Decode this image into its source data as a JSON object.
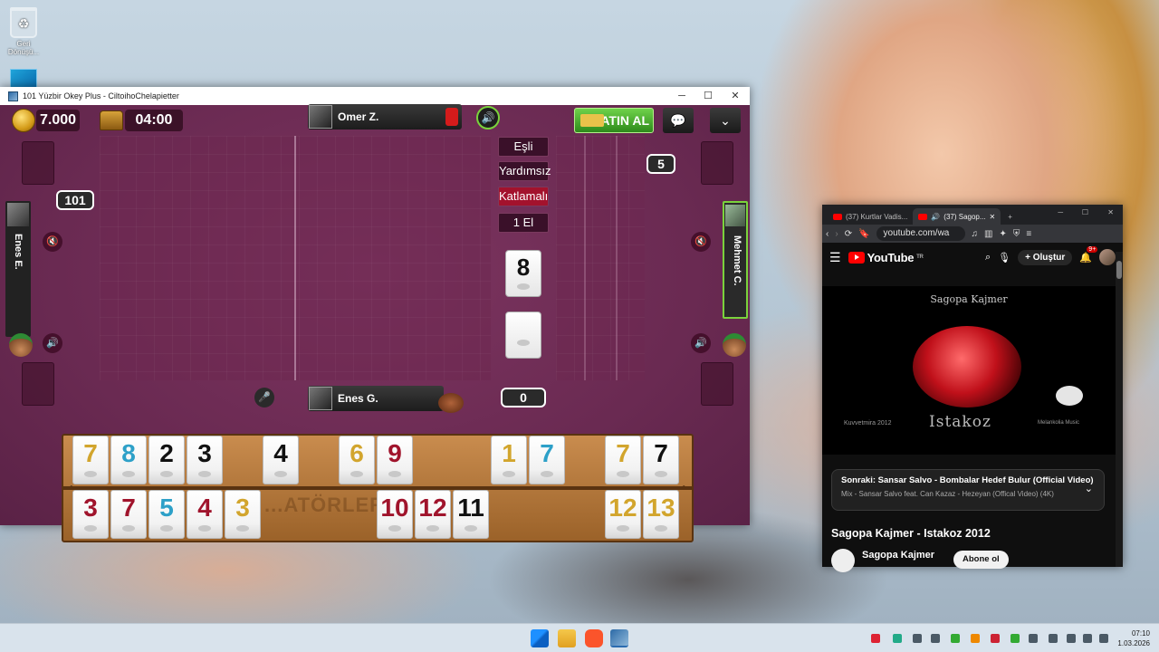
{
  "desktop": {
    "recycle_bin_label": "Geri Dönüşü...",
    "second_icon_label": ""
  },
  "game_window": {
    "title": "101 Yüzbir Okey Plus - CiltoihoChelapietter",
    "controls": {
      "minimize": "─",
      "maximize": "☐",
      "close": "✕"
    },
    "coins": "7.000",
    "timer": "04:00",
    "top_player": "Omer Z.",
    "bottom_player": "Enes G.",
    "left_player": "Enes E.",
    "right_player": "Mehmet C.",
    "buy_button": "SATIN AL",
    "rules": [
      "Eşli",
      "Yardımsız",
      "Katlamalı",
      "1 El"
    ],
    "score_left": "101",
    "score_right": "5",
    "score_bottom": "0",
    "indicator_tile": "8",
    "rack_watermark": "...ATÖRLER...",
    "rack_top": [
      {
        "v": "7",
        "c": "y"
      },
      {
        "v": "8",
        "c": "b"
      },
      {
        "v": "2",
        "c": "k"
      },
      {
        "v": "3",
        "c": "k"
      },
      {
        "v": "4",
        "c": "k"
      },
      {
        "v": "6",
        "c": "y"
      },
      {
        "v": "9",
        "c": "r"
      },
      {
        "v": "1",
        "c": "y"
      },
      {
        "v": "7",
        "c": "b"
      },
      {
        "v": "7",
        "c": "y"
      },
      {
        "v": "7",
        "c": "k"
      }
    ],
    "rack_bottom": [
      {
        "v": "3",
        "c": "r"
      },
      {
        "v": "7",
        "c": "r"
      },
      {
        "v": "5",
        "c": "b"
      },
      {
        "v": "4",
        "c": "r"
      },
      {
        "v": "3",
        "c": "y"
      },
      {
        "v": "10",
        "c": "r"
      },
      {
        "v": "12",
        "c": "r"
      },
      {
        "v": "11",
        "c": "k"
      },
      {
        "v": "12",
        "c": "y"
      },
      {
        "v": "13",
        "c": "y"
      }
    ]
  },
  "browser": {
    "tabs": [
      {
        "label": "(37) Kurtlar Vadis..."
      },
      {
        "label": "(37) Sagop..."
      }
    ],
    "new_tab": "+",
    "url": "youtube.com/wa",
    "yt_logo": "YouTube",
    "yt_region": "TR",
    "create_label": "Oluştur",
    "notif_count": "9+",
    "video_title_art": "Istakoz",
    "video_top_art": "Sagopa Kajmer",
    "art_left": "Kuvvetmira 2012",
    "art_right": "Melankolia Music",
    "up_next": "Sonraki: Sansar Salvo - Bombalar Hedef Bulur (Official Video)",
    "mix_line": "Mix - Sansar Salvo feat. Can Kazaz - Hezeyan (Offical Video) (4K)",
    "video_title": "Sagopa Kajmer - Istakoz 2012",
    "channel": "Sagopa Kajmer",
    "subscribe": "Abone ol"
  },
  "taskbar": {
    "time": "07:10",
    "date": "1.03.2026"
  }
}
